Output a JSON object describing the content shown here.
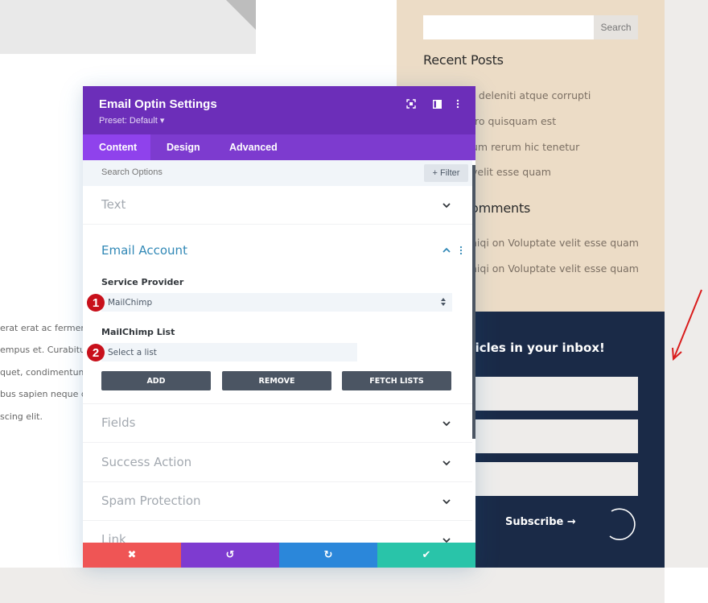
{
  "background": {
    "sidebar": {
      "search_placeholder": "",
      "search_button": "Search",
      "recent_posts_heading": "Recent Posts",
      "recent_posts": [
        "n deleniti atque corrupti",
        "ro quisquam est",
        "um rerum hic tenetur",
        "velit esse quam"
      ],
      "recent_comments_heading": "omments",
      "recent_comments": [
        "niqi on Voluptate velit esse quam",
        "niqi on Voluptate velit esse quam"
      ]
    },
    "optin_block": {
      "title": "rticles in your inbox!",
      "subscribe_label": "Subscribe →"
    },
    "left_text_lines": [
      "erat erat ac ferment",
      "empus et. Curabitur",
      "quet, condimentum",
      "bus sapien neque qu",
      "scing elit."
    ],
    "colors": {
      "sidebar_bg": "#ecdcc6",
      "navy_bg": "#1a2a47",
      "annotation_arrow": "#d91c1c"
    }
  },
  "modal": {
    "title": "Email Optin Settings",
    "preset": "Preset: Default ▾",
    "header_icons": [
      "focus-icon",
      "split-view-icon",
      "more-vertical-icon"
    ],
    "tabs": [
      {
        "label": "Content",
        "active": true
      },
      {
        "label": "Design",
        "active": false
      },
      {
        "label": "Advanced",
        "active": false
      }
    ],
    "search_placeholder": "Search Options",
    "filter_label": "+ Filter",
    "sections": {
      "text": "Text",
      "email_account": "Email Account",
      "fields": "Fields",
      "success_action": "Success Action",
      "spam_protection": "Spam Protection",
      "link": "Link"
    },
    "email_account": {
      "service_provider_label": "Service Provider",
      "service_provider_value": "MailChimp",
      "list_label": "MailChimp List",
      "list_value": "Select a list",
      "badges": [
        "1",
        "2"
      ],
      "buttons": {
        "add": "ADD",
        "remove": "REMOVE",
        "fetch": "FETCH LISTS"
      }
    },
    "footer": {
      "cancel": "✖",
      "undo": "↺",
      "redo": "↻",
      "save": "✔"
    },
    "colors": {
      "header": "#6c2eb9",
      "tabs": "#7d3bcf",
      "active_tab": "#8f42ec",
      "open_section_title": "#3188b6",
      "cancel": "#ef5555",
      "undo": "#7e3bd0",
      "redo": "#2b87da",
      "save": "#29c4a9",
      "badge": "#c8101b"
    }
  }
}
